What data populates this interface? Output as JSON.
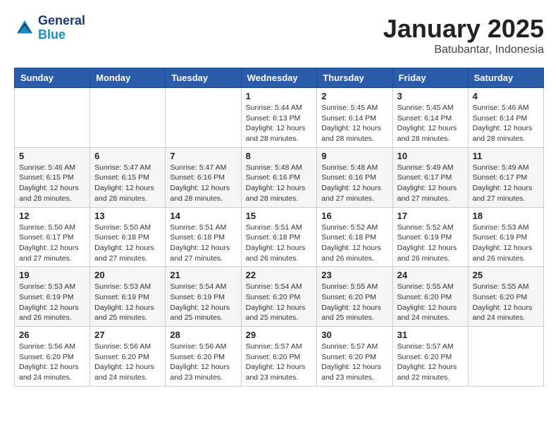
{
  "header": {
    "logo_line1": "General",
    "logo_line2": "Blue",
    "month": "January 2025",
    "location": "Batubantar, Indonesia"
  },
  "weekdays": [
    "Sunday",
    "Monday",
    "Tuesday",
    "Wednesday",
    "Thursday",
    "Friday",
    "Saturday"
  ],
  "weeks": [
    [
      {
        "day": "",
        "info": ""
      },
      {
        "day": "",
        "info": ""
      },
      {
        "day": "",
        "info": ""
      },
      {
        "day": "1",
        "info": "Sunrise: 5:44 AM\nSunset: 6:13 PM\nDaylight: 12 hours\nand 28 minutes."
      },
      {
        "day": "2",
        "info": "Sunrise: 5:45 AM\nSunset: 6:14 PM\nDaylight: 12 hours\nand 28 minutes."
      },
      {
        "day": "3",
        "info": "Sunrise: 5:45 AM\nSunset: 6:14 PM\nDaylight: 12 hours\nand 28 minutes."
      },
      {
        "day": "4",
        "info": "Sunrise: 5:46 AM\nSunset: 6:14 PM\nDaylight: 12 hours\nand 28 minutes."
      }
    ],
    [
      {
        "day": "5",
        "info": "Sunrise: 5:46 AM\nSunset: 6:15 PM\nDaylight: 12 hours\nand 28 minutes."
      },
      {
        "day": "6",
        "info": "Sunrise: 5:47 AM\nSunset: 6:15 PM\nDaylight: 12 hours\nand 28 minutes."
      },
      {
        "day": "7",
        "info": "Sunrise: 5:47 AM\nSunset: 6:16 PM\nDaylight: 12 hours\nand 28 minutes."
      },
      {
        "day": "8",
        "info": "Sunrise: 5:48 AM\nSunset: 6:16 PM\nDaylight: 12 hours\nand 28 minutes."
      },
      {
        "day": "9",
        "info": "Sunrise: 5:48 AM\nSunset: 6:16 PM\nDaylight: 12 hours\nand 27 minutes."
      },
      {
        "day": "10",
        "info": "Sunrise: 5:49 AM\nSunset: 6:17 PM\nDaylight: 12 hours\nand 27 minutes."
      },
      {
        "day": "11",
        "info": "Sunrise: 5:49 AM\nSunset: 6:17 PM\nDaylight: 12 hours\nand 27 minutes."
      }
    ],
    [
      {
        "day": "12",
        "info": "Sunrise: 5:50 AM\nSunset: 6:17 PM\nDaylight: 12 hours\nand 27 minutes."
      },
      {
        "day": "13",
        "info": "Sunrise: 5:50 AM\nSunset: 6:18 PM\nDaylight: 12 hours\nand 27 minutes."
      },
      {
        "day": "14",
        "info": "Sunrise: 5:51 AM\nSunset: 6:18 PM\nDaylight: 12 hours\nand 27 minutes."
      },
      {
        "day": "15",
        "info": "Sunrise: 5:51 AM\nSunset: 6:18 PM\nDaylight: 12 hours\nand 26 minutes."
      },
      {
        "day": "16",
        "info": "Sunrise: 5:52 AM\nSunset: 6:18 PM\nDaylight: 12 hours\nand 26 minutes."
      },
      {
        "day": "17",
        "info": "Sunrise: 5:52 AM\nSunset: 6:19 PM\nDaylight: 12 hours\nand 26 minutes."
      },
      {
        "day": "18",
        "info": "Sunrise: 5:53 AM\nSunset: 6:19 PM\nDaylight: 12 hours\nand 26 minutes."
      }
    ],
    [
      {
        "day": "19",
        "info": "Sunrise: 5:53 AM\nSunset: 6:19 PM\nDaylight: 12 hours\nand 26 minutes."
      },
      {
        "day": "20",
        "info": "Sunrise: 5:53 AM\nSunset: 6:19 PM\nDaylight: 12 hours\nand 25 minutes."
      },
      {
        "day": "21",
        "info": "Sunrise: 5:54 AM\nSunset: 6:19 PM\nDaylight: 12 hours\nand 25 minutes."
      },
      {
        "day": "22",
        "info": "Sunrise: 5:54 AM\nSunset: 6:20 PM\nDaylight: 12 hours\nand 25 minutes."
      },
      {
        "day": "23",
        "info": "Sunrise: 5:55 AM\nSunset: 6:20 PM\nDaylight: 12 hours\nand 25 minutes."
      },
      {
        "day": "24",
        "info": "Sunrise: 5:55 AM\nSunset: 6:20 PM\nDaylight: 12 hours\nand 24 minutes."
      },
      {
        "day": "25",
        "info": "Sunrise: 5:55 AM\nSunset: 6:20 PM\nDaylight: 12 hours\nand 24 minutes."
      }
    ],
    [
      {
        "day": "26",
        "info": "Sunrise: 5:56 AM\nSunset: 6:20 PM\nDaylight: 12 hours\nand 24 minutes."
      },
      {
        "day": "27",
        "info": "Sunrise: 5:56 AM\nSunset: 6:20 PM\nDaylight: 12 hours\nand 24 minutes."
      },
      {
        "day": "28",
        "info": "Sunrise: 5:56 AM\nSunset: 6:20 PM\nDaylight: 12 hours\nand 23 minutes."
      },
      {
        "day": "29",
        "info": "Sunrise: 5:57 AM\nSunset: 6:20 PM\nDaylight: 12 hours\nand 23 minutes."
      },
      {
        "day": "30",
        "info": "Sunrise: 5:57 AM\nSunset: 6:20 PM\nDaylight: 12 hours\nand 23 minutes."
      },
      {
        "day": "31",
        "info": "Sunrise: 5:57 AM\nSunset: 6:20 PM\nDaylight: 12 hours\nand 22 minutes."
      },
      {
        "day": "",
        "info": ""
      }
    ]
  ]
}
